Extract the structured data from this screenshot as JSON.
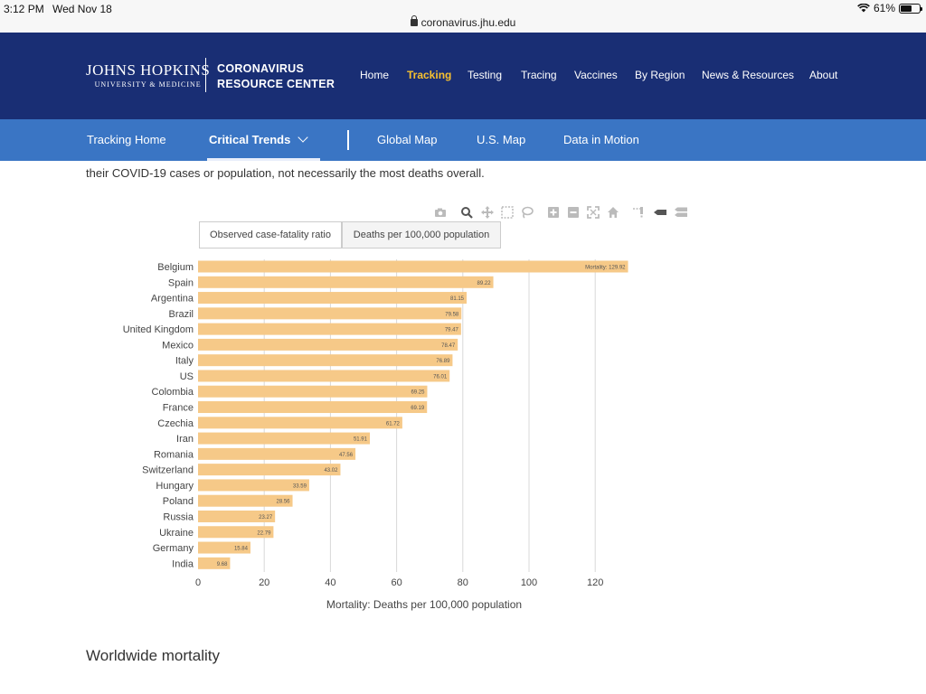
{
  "status_bar": {
    "time": "3:12 PM",
    "date": "Wed Nov 18",
    "url": "coronavirus.jhu.edu",
    "battery": "61%",
    "battery_level": 0.61
  },
  "header": {
    "logo_main": "JOHNS HOPKINS",
    "logo_sub": "UNIVERSITY & MEDICINE",
    "site_title_line1": "CORONAVIRUS",
    "site_title_line2": "RESOURCE CENTER",
    "nav": [
      {
        "label": "Home"
      },
      {
        "label": "Tracking",
        "active": true
      },
      {
        "label": "Testing"
      },
      {
        "label": "Tracing"
      },
      {
        "label": "Vaccines"
      },
      {
        "label": "By Region"
      },
      {
        "label": "News & Resources"
      },
      {
        "label": "About"
      }
    ],
    "colors": {
      "header_bg": "#192e74",
      "active": "#f8c12f",
      "subnav_bg": "#3a75c4"
    }
  },
  "subnav": {
    "items": [
      {
        "label": "Tracking Home"
      },
      {
        "label": "Critical Trends",
        "active": true
      },
      {
        "label": "Global Map"
      },
      {
        "label": "U.S. Map"
      },
      {
        "label": "Data in Motion"
      }
    ]
  },
  "intro_text": "their COVID-19 cases or population, not necessarily the most deaths overall.",
  "modebar_icons": [
    "camera-icon",
    "zoom-icon",
    "pan-icon",
    "box-select-icon",
    "lasso-icon",
    "zoom-in-icon",
    "zoom-out-icon",
    "autoscale-icon",
    "reset-axes-icon",
    "spike-lines-icon",
    "hover-closest-icon",
    "hover-compare-icon"
  ],
  "toggles": [
    {
      "label": "Observed case-fatality ratio",
      "selected": false
    },
    {
      "label": "Deaths per 100,000 population",
      "selected": true
    }
  ],
  "chart_data": {
    "type": "bar",
    "orientation": "horizontal",
    "categories": [
      "Belgium",
      "Spain",
      "Argentina",
      "Brazil",
      "United Kingdom",
      "Mexico",
      "Italy",
      "US",
      "Colombia",
      "France",
      "Czechia",
      "Iran",
      "Romania",
      "Switzerland",
      "Hungary",
      "Poland",
      "Russia",
      "Ukraine",
      "Germany",
      "India"
    ],
    "values": [
      129.92,
      89.22,
      81.15,
      79.58,
      79.47,
      78.47,
      76.89,
      76.01,
      69.25,
      69.19,
      61.72,
      51.91,
      47.56,
      43.02,
      33.59,
      28.56,
      23.27,
      22.79,
      15.84,
      9.68
    ],
    "value_labels": [
      "Mortality: 129.92",
      "89.22",
      "81.15",
      "79.58",
      "79.47",
      "78.47",
      "76.89",
      "76.01",
      "69.25",
      "69.19",
      "61.72",
      "51.91",
      "47.56",
      "43.02",
      "33.59",
      "28.56",
      "23.27",
      "22.79",
      "15.84",
      "9.68"
    ],
    "xlabel": "Mortality: Deaths per 100,000 population",
    "ylabel": "",
    "xlim": [
      0,
      130
    ],
    "xticks": [
      0,
      20,
      40,
      60,
      80,
      100,
      120
    ],
    "grid": "vertical",
    "bar_color": "#f6c988"
  },
  "section_title": "Worldwide mortality"
}
